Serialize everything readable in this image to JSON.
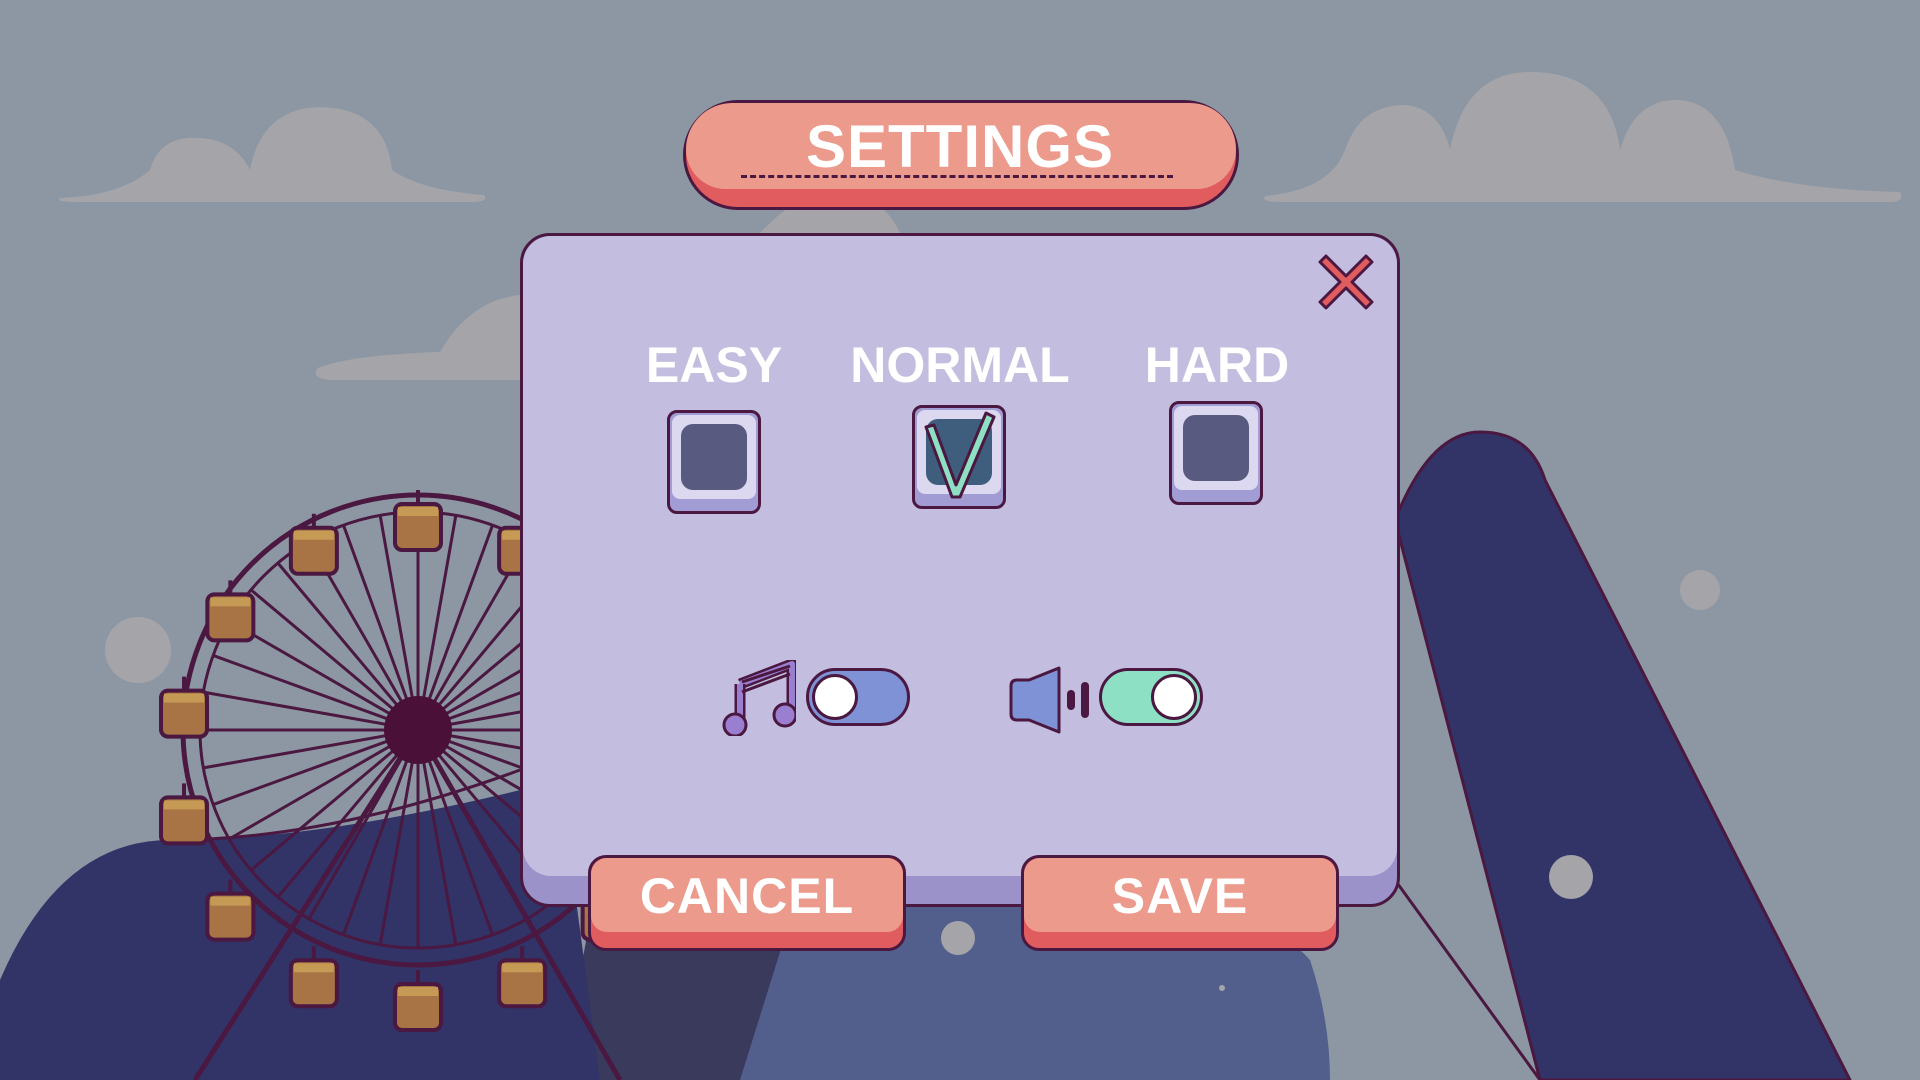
{
  "screen": {
    "title": "SETTINGS"
  },
  "difficulty": {
    "options": [
      {
        "label": "EASY",
        "checked": false
      },
      {
        "label": "NORMAL",
        "checked": true
      },
      {
        "label": "HARD",
        "checked": false
      }
    ]
  },
  "audio": {
    "music": {
      "icon": "music-note-icon",
      "enabled": false,
      "track_color": "#7f92d6"
    },
    "sound": {
      "icon": "speaker-icon",
      "enabled": true,
      "track_color": "#8ee0c5"
    }
  },
  "buttons": {
    "cancel": "CANCEL",
    "save": "SAVE",
    "close_icon": "close-icon"
  },
  "colors": {
    "background": "#8d97a3",
    "panel": "#c3bedf",
    "button": "#ec9a8c",
    "button_shadow": "#e05c5f",
    "outline": "#4a1840",
    "hill": "#323366"
  }
}
